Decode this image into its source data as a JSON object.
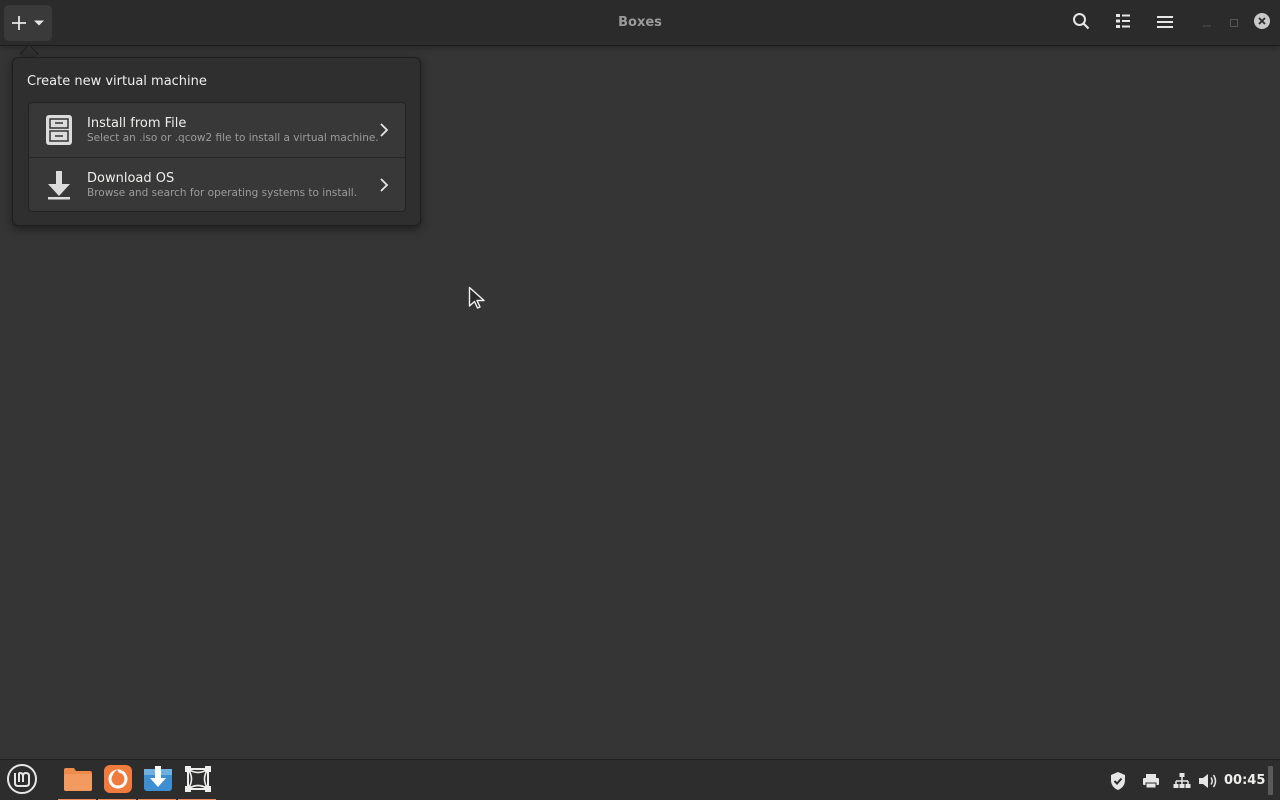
{
  "window": {
    "title": "Boxes"
  },
  "header": {
    "new_button_icon": "plus-icon",
    "new_button_dropdown_icon": "chevron-down-icon",
    "search_icon": "search-icon",
    "view_icon": "list-view-icon",
    "menu_icon": "hamburger-menu-icon"
  },
  "popover": {
    "heading": "Create new virtual machine",
    "options": [
      {
        "title": "Install from File",
        "subtitle": "Select an .iso or .qcow2 file to install a virtual machine.",
        "icon": "file-cabinet-icon"
      },
      {
        "title": "Download OS",
        "subtitle": "Browse and search for operating systems to install.",
        "icon": "download-arrow-icon"
      }
    ]
  },
  "taskbar": {
    "apps": [
      {
        "name": "Files",
        "icon": "folder-icon",
        "color": "#f08a4b"
      },
      {
        "name": "Firefox",
        "icon": "firefox-icon",
        "color": "#f07b3c"
      },
      {
        "name": "Update Manager",
        "icon": "update-manager-icon",
        "color": "#3d8fd1"
      },
      {
        "name": "Boxes",
        "icon": "boxes-icon",
        "color": "#eeeeec"
      }
    ],
    "tray": {
      "clock": "00:45"
    }
  },
  "colors": {
    "window_bg": "#353535",
    "headerbar_bg": "#2b2b2b",
    "popover_bg": "#2f2f2f",
    "accent": "#f18b5a"
  }
}
